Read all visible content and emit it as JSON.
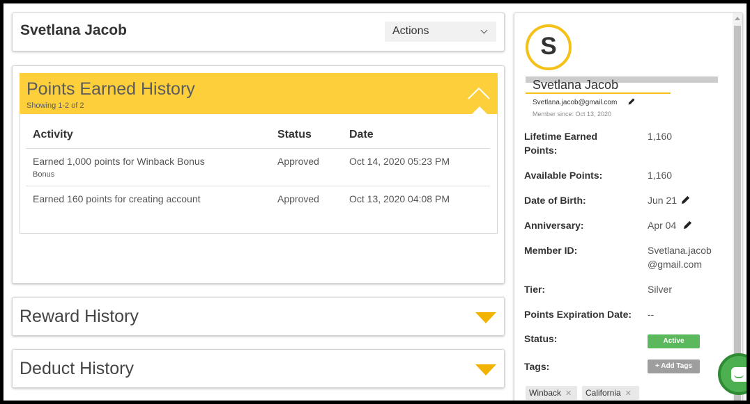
{
  "member": {
    "name": "Svetlana Jacob",
    "actions_label": "Actions"
  },
  "points_history": {
    "title": "Points Earned History",
    "subtitle": "Showing 1-2 of 2",
    "columns": [
      "Activity",
      "Status",
      "Date"
    ],
    "rows": [
      {
        "activity": "Earned 1,000 points for Winback Bonus",
        "sub": "Bonus",
        "status": "Approved",
        "date": "Oct 14, 2020 05:23 PM"
      },
      {
        "activity": "Earned 160 points for creating account",
        "sub": "",
        "status": "Approved",
        "date": "Oct 13, 2020 04:08 PM"
      }
    ]
  },
  "reward_history": {
    "title": "Reward History"
  },
  "deduct_history": {
    "title": "Deduct History"
  },
  "profile": {
    "avatar_letter": "S",
    "name": "Svetlana Jacob",
    "email": "Svetlana.jacob@gmail.com",
    "member_since": "Member since: Oct 13, 2020",
    "fields": {
      "lifetime_label": "Lifetime Earned Points:",
      "lifetime_value": "1,160",
      "available_label": "Available Points:",
      "available_value": "1,160",
      "dob_label": "Date of Birth:",
      "dob_value": "Jun 21",
      "anniversary_label": "Anniversary:",
      "anniversary_value": "Apr 04",
      "member_id_label": "Member ID:",
      "member_id_line1": "Svetlana.jacob",
      "member_id_line2": "@gmail.com",
      "tier_label": "Tier:",
      "tier_value": "Silver",
      "expiration_label": "Points Expiration Date:",
      "expiration_value": "--",
      "status_label": "Status:",
      "status_value": "Active",
      "tags_label": "Tags:",
      "add_tags_label": "+ Add Tags"
    },
    "tags": [
      "Winback",
      "California"
    ]
  },
  "colors": {
    "accent_yellow": "#fccf3b",
    "caret_yellow": "#f2b200",
    "status_green": "#5cb85c",
    "chat_green": "#4caf50"
  },
  "icons": [
    "chevron-down-icon",
    "chevron-up-icon",
    "caret-down-icon",
    "pencil-icon",
    "close-icon",
    "chat-icon"
  ]
}
